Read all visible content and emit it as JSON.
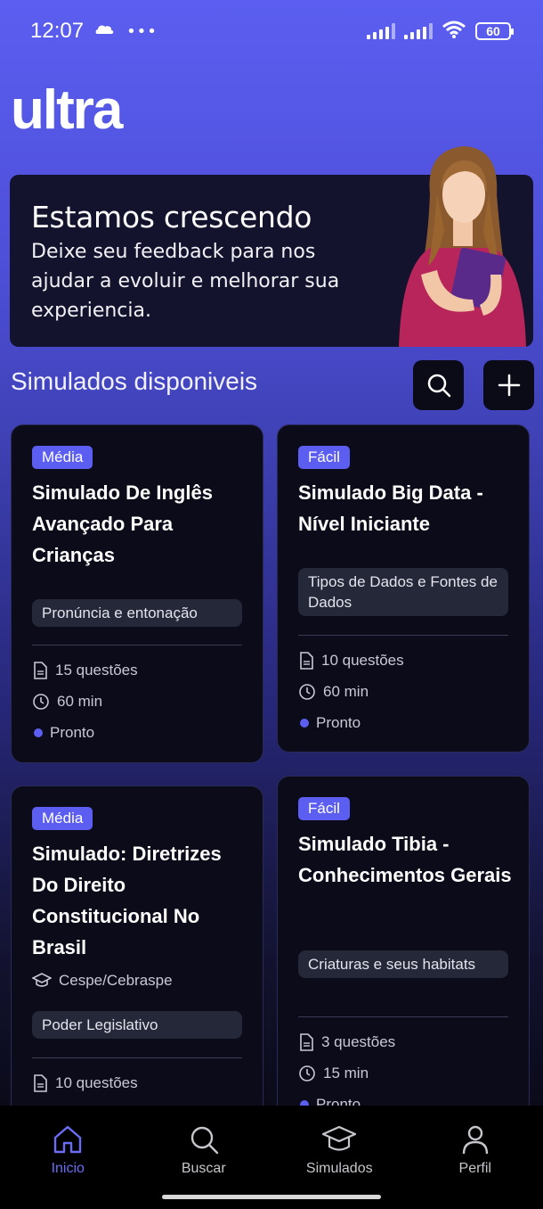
{
  "status": {
    "time": "12:07",
    "battery": "60"
  },
  "logo": "ultra",
  "banner": {
    "title": "Estamos crescendo",
    "text": "Deixe seu feedback para nos ajudar a evoluir e melhorar sua experiencia."
  },
  "section": {
    "title": "Simulados disponiveis"
  },
  "cards": [
    {
      "difficulty": "Média",
      "title": "Simulado De Inglês Avançado Para Crianças",
      "tag": "Pronúncia e entonação",
      "questions": "15 questões",
      "duration": "60 min",
      "status": "Pronto"
    },
    {
      "difficulty": "Fácil",
      "title": "Simulado Big Data - Nível Iniciante",
      "tag": "Tipos de Dados e Fontes de Dados",
      "questions": "10 questões",
      "duration": "60 min",
      "status": "Pronto"
    },
    {
      "difficulty": "Média",
      "title": "Simulado: Diretrizes Do Direito Constitucional No Brasil",
      "board": "Cespe/Cebraspe",
      "tag": "Poder Legislativo",
      "questions": "10 questões"
    },
    {
      "difficulty": "Fácil",
      "title": "Simulado Tibia - Conhecimentos Gerais",
      "tag": "Criaturas e seus habitats",
      "questions": "3 questões",
      "duration": "15 min",
      "status": "Pronto"
    }
  ],
  "nav": {
    "home": "Inicio",
    "search": "Buscar",
    "simulados": "Simulados",
    "profile": "Perfil"
  },
  "colors": {
    "accent": "#5b5ef0",
    "card_bg": "#0b0b1a",
    "banner_bg": "#13132e"
  }
}
